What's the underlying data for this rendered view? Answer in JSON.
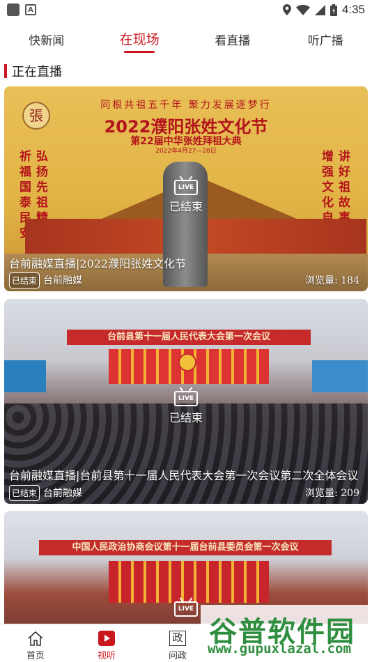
{
  "status_bar": {
    "time": "4:35",
    "icons": [
      "notification-icon",
      "a-icon",
      "location-icon",
      "wifi-icon",
      "signal-icon",
      "battery-icon"
    ]
  },
  "tabs": [
    {
      "label": "快新闻",
      "active": false
    },
    {
      "label": "在现场",
      "active": true
    },
    {
      "label": "看直播",
      "active": false
    },
    {
      "label": "听广播",
      "active": false
    }
  ],
  "section": {
    "title": "正在直播"
  },
  "cards": [
    {
      "title": "台前融媒直播|2022濮阳张姓文化节",
      "status": "已结束",
      "badge": "已结束",
      "source": "台前融媒",
      "views": "浏览量: 184",
      "live_label": "LIVE",
      "poster": {
        "subtitle": "同根共祖五千年  聚力发展逐梦行",
        "title": "2022濮阳张姓文化节",
        "title2": "第22届中华张姓拜祖大典",
        "date": "2022年4月27—28日",
        "left_cols": [
          "祈福国泰民安",
          "弘扬先祖精神"
        ],
        "right_cols": [
          "增强文化自信",
          "讲好祖故事"
        ],
        "logo_char": "張"
      }
    },
    {
      "title": "台前融媒直播|台前县第十一届人民代表大会第一次会议第二次全体会议",
      "status": "已结束",
      "badge": "已结束",
      "source": "台前融媒",
      "views": "浏览量: 209",
      "live_label": "LIVE",
      "banner": "台前县第十一届人民代表大会第一次会议"
    },
    {
      "live_label": "LIVE",
      "banner": "中国人民政治协商会议第十一届台前县委员会第一次会议"
    }
  ],
  "bottom_nav": [
    {
      "label": "首页",
      "icon": "home-icon",
      "active": false
    },
    {
      "label": "视听",
      "icon": "video-icon",
      "active": true
    },
    {
      "label": "问政",
      "icon": "zheng-icon",
      "icon_char": "政",
      "active": false
    }
  ],
  "watermark": {
    "logo": "谷普软件园",
    "url": "www.gupuxlazal.com"
  },
  "colors": {
    "accent": "#c9171e"
  }
}
